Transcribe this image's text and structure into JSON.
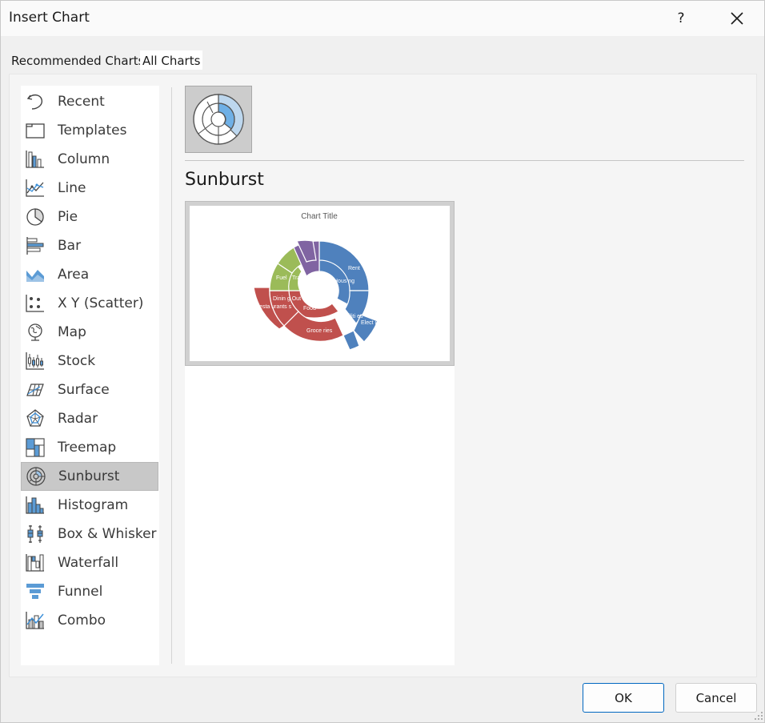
{
  "window": {
    "title": "Insert Chart",
    "help_label": "?"
  },
  "tabs": [
    {
      "label": "Recommended Charts"
    },
    {
      "label": "All Charts"
    }
  ],
  "chart_types": [
    {
      "label": "Recent",
      "icon": "recent-icon"
    },
    {
      "label": "Templates",
      "icon": "templates-icon"
    },
    {
      "label": "Column",
      "icon": "column-chart-icon"
    },
    {
      "label": "Line",
      "icon": "line-chart-icon"
    },
    {
      "label": "Pie",
      "icon": "pie-chart-icon"
    },
    {
      "label": "Bar",
      "icon": "bar-chart-icon"
    },
    {
      "label": "Area",
      "icon": "area-chart-icon"
    },
    {
      "label": "X Y (Scatter)",
      "icon": "scatter-chart-icon"
    },
    {
      "label": "Map",
      "icon": "map-chart-icon"
    },
    {
      "label": "Stock",
      "icon": "stock-chart-icon"
    },
    {
      "label": "Surface",
      "icon": "surface-chart-icon"
    },
    {
      "label": "Radar",
      "icon": "radar-chart-icon"
    },
    {
      "label": "Treemap",
      "icon": "treemap-chart-icon"
    },
    {
      "label": "Sunburst",
      "icon": "sunburst-chart-icon",
      "selected": true
    },
    {
      "label": "Histogram",
      "icon": "histogram-chart-icon"
    },
    {
      "label": "Box & Whisker",
      "icon": "box-whisker-chart-icon"
    },
    {
      "label": "Waterfall",
      "icon": "waterfall-chart-icon"
    },
    {
      "label": "Funnel",
      "icon": "funnel-chart-icon"
    },
    {
      "label": "Combo",
      "icon": "combo-chart-icon"
    }
  ],
  "selected_type": {
    "name": "Sunburst",
    "subtype_icon": "sunburst-subtype-icon"
  },
  "preview": {
    "chart_title": "Chart Title",
    "labels": {
      "housing": "Hous ng",
      "rent": "Rent",
      "utilities": "Utiliti es",
      "electricity": "Elect icity",
      "food": "Food",
      "groceries": "Groce ries",
      "dining_out": "Dinin g Out",
      "restaurants": "Resta urants s",
      "transport": "Trans port",
      "fuel": "Fuel"
    }
  },
  "colors": {
    "accent": "#0067c0",
    "blue": "#4f81bd",
    "red": "#c0504d",
    "green": "#9bbb59",
    "purple": "#8064a2"
  },
  "footer": {
    "ok_label": "OK",
    "cancel_label": "Cancel"
  }
}
